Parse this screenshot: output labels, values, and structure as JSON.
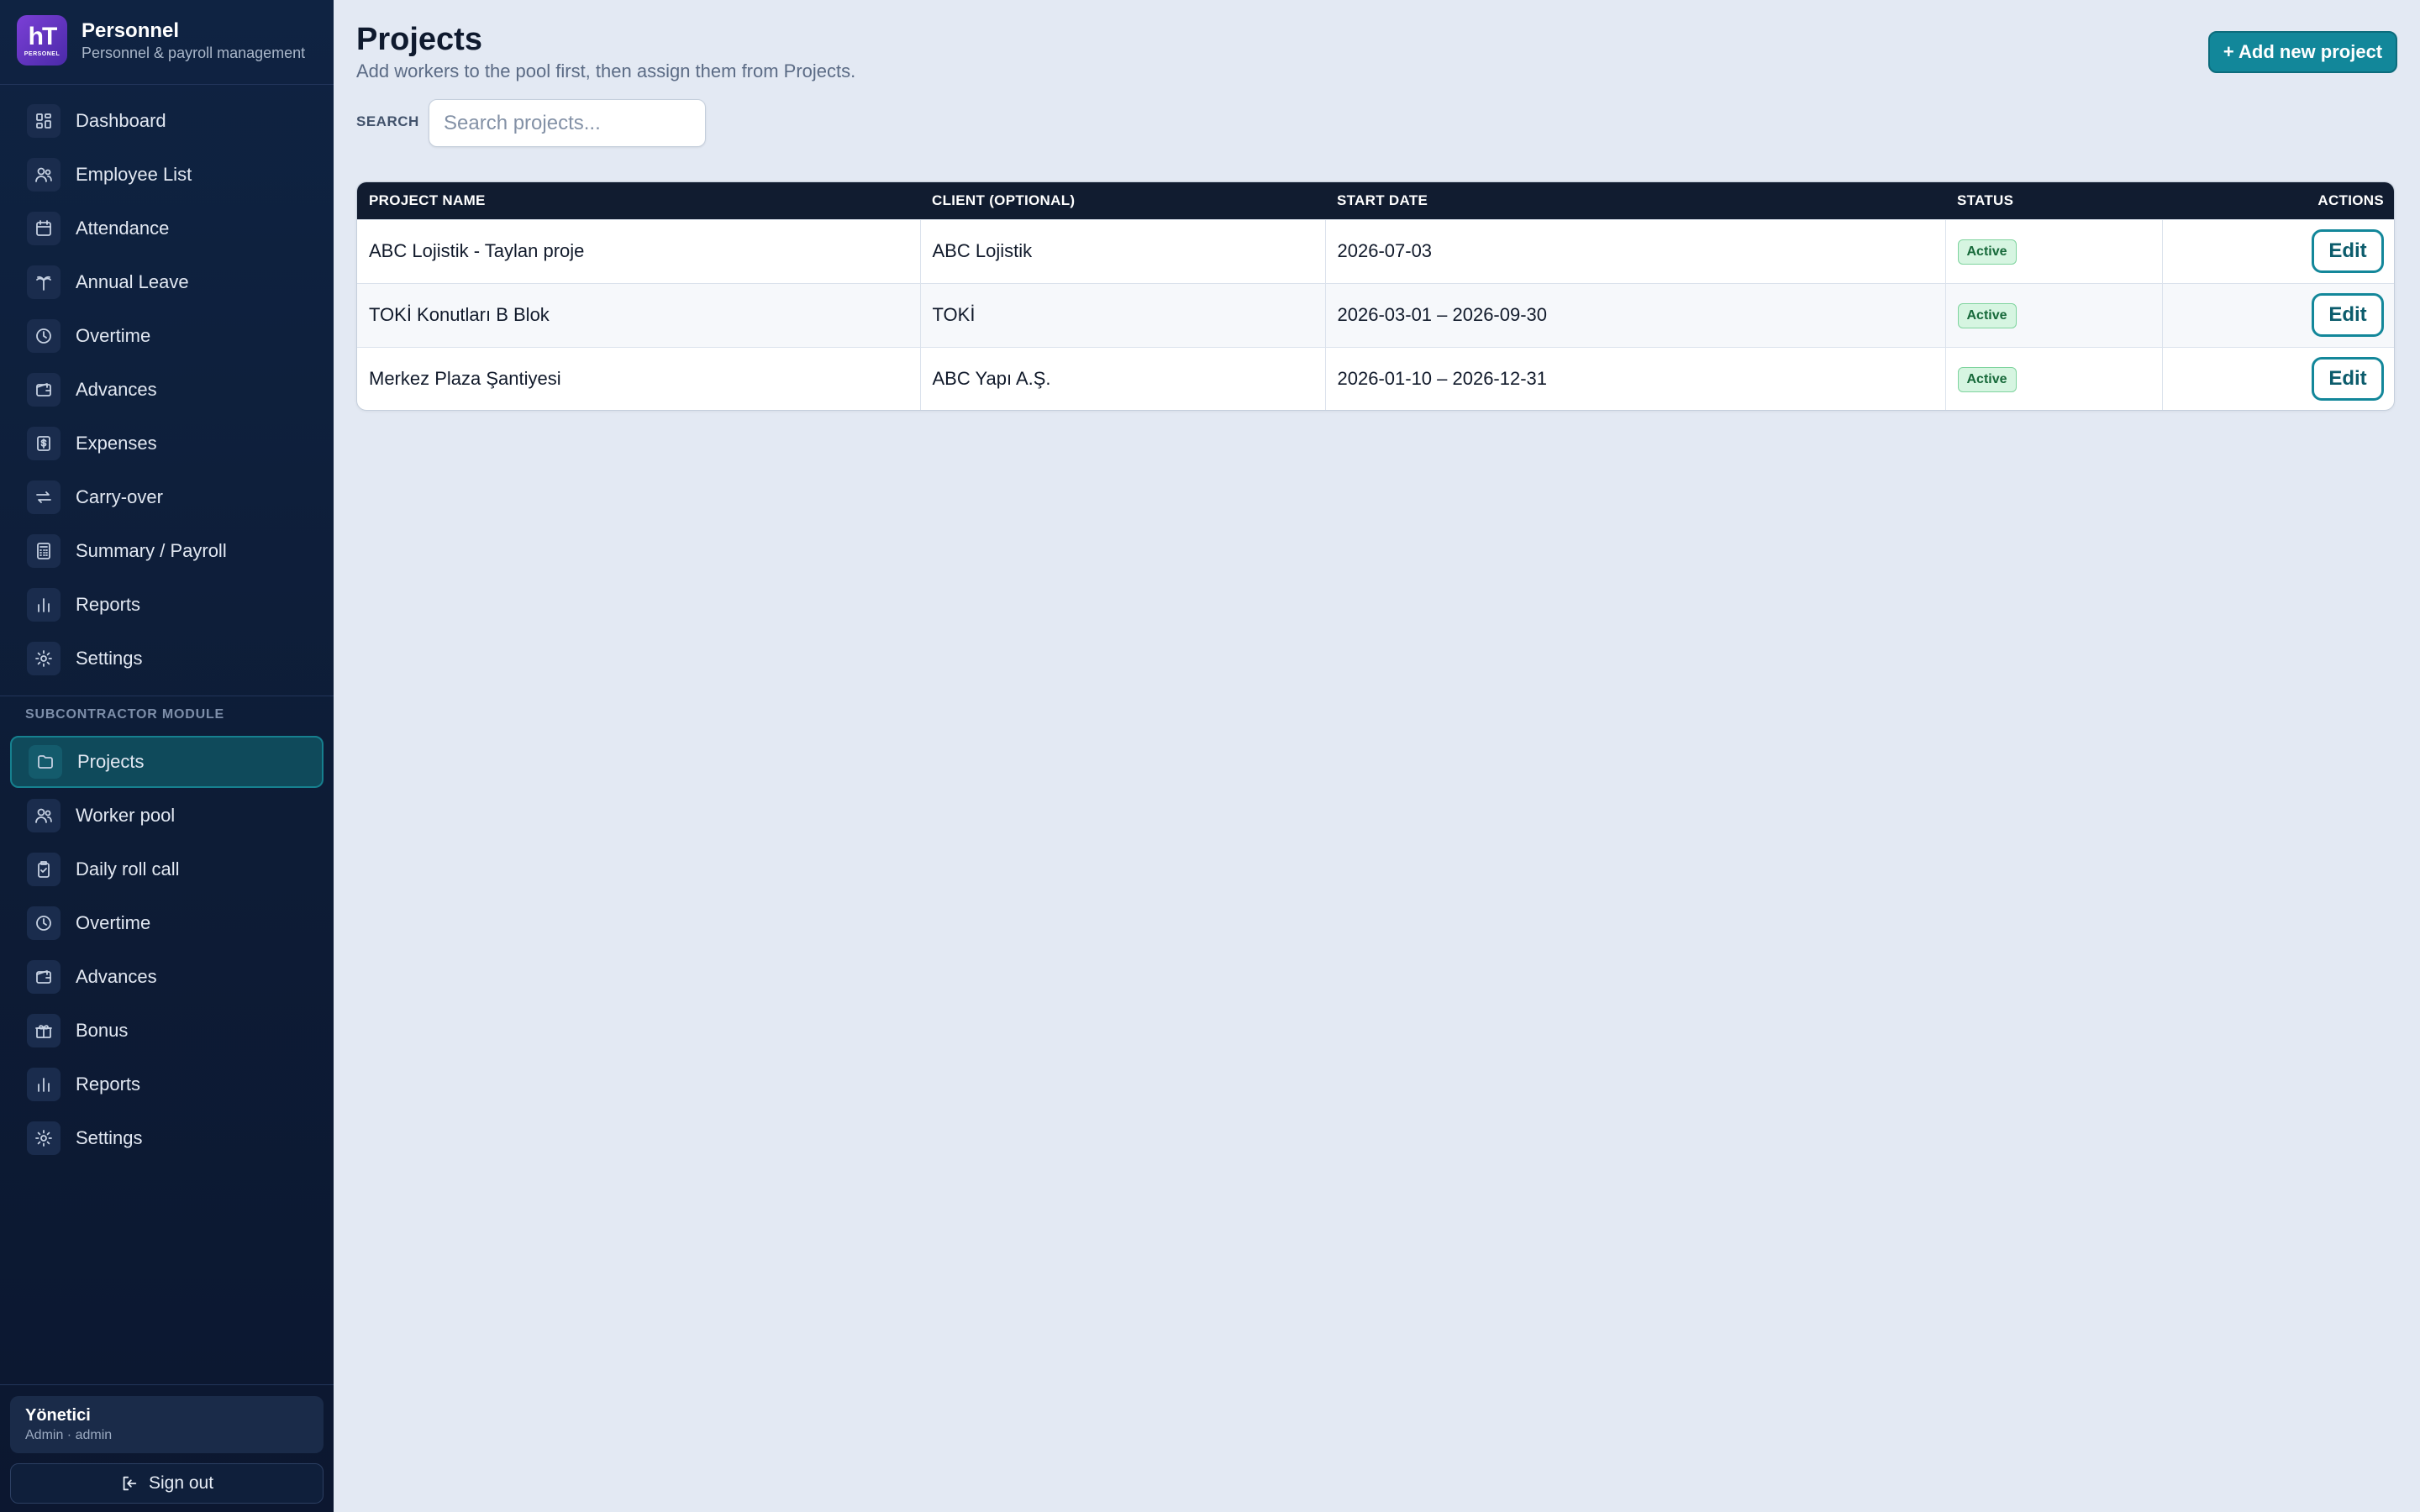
{
  "brand": {
    "logo_mark": "hT",
    "logo_caption": "PERSONEL",
    "name": "Personnel",
    "subtitle": "Personnel & payroll management"
  },
  "nav_main": [
    {
      "label": "Dashboard",
      "icon": "dashboard-icon"
    },
    {
      "label": "Employee List",
      "icon": "users-icon"
    },
    {
      "label": "Attendance",
      "icon": "calendar-icon"
    },
    {
      "label": "Annual Leave",
      "icon": "palm-tree-icon"
    },
    {
      "label": "Overtime",
      "icon": "clock-icon"
    },
    {
      "label": "Advances",
      "icon": "wallet-icon"
    },
    {
      "label": "Expenses",
      "icon": "receipt-icon"
    },
    {
      "label": "Carry-over",
      "icon": "arrows-icon"
    },
    {
      "label": "Summary / Payroll",
      "icon": "calculator-icon"
    },
    {
      "label": "Reports",
      "icon": "bar-chart-icon"
    },
    {
      "label": "Settings",
      "icon": "gear-icon"
    }
  ],
  "section_label": "SUBCONTRACTOR MODULE",
  "nav_sub": [
    {
      "label": "Projects",
      "icon": "folder-icon",
      "active": true
    },
    {
      "label": "Worker pool",
      "icon": "users-icon"
    },
    {
      "label": "Daily roll call",
      "icon": "clipboard-check-icon"
    },
    {
      "label": "Overtime",
      "icon": "clock-icon"
    },
    {
      "label": "Advances",
      "icon": "wallet-icon"
    },
    {
      "label": "Bonus",
      "icon": "gift-icon"
    },
    {
      "label": "Reports",
      "icon": "bar-chart-icon"
    },
    {
      "label": "Settings",
      "icon": "gear-icon"
    }
  ],
  "user": {
    "name": "Yönetici",
    "role": "Admin · admin"
  },
  "signout_label": "Sign out",
  "page": {
    "title": "Projects",
    "subtitle": "Add workers to the pool first, then assign them from Projects.",
    "add_button": "+ Add new project",
    "search_label": "SEARCH",
    "search_placeholder": "Search projects..."
  },
  "table": {
    "headers": [
      "PROJECT NAME",
      "CLIENT (OPTIONAL)",
      "START DATE",
      "STATUS",
      "ACTIONS"
    ],
    "rows": [
      {
        "name": "ABC Lojistik - Taylan proje",
        "client": "ABC Lojistik",
        "date": "2026-07-03",
        "status": "Active",
        "action": "Edit"
      },
      {
        "name": "TOKİ Konutları B Blok",
        "client": "TOKİ",
        "date": "2026-03-01 – 2026-09-30",
        "status": "Active",
        "action": "Edit"
      },
      {
        "name": "Merkez Plaza Şantiyesi",
        "client": "ABC Yapı A.Ş.",
        "date": "2026-01-10 – 2026-12-31",
        "status": "Active",
        "action": "Edit"
      }
    ]
  },
  "colors": {
    "accent": "#12879a",
    "sidebar_bg": "#0f2342",
    "status_active_bg": "#d6f5e1",
    "status_active_text": "#17693a"
  }
}
